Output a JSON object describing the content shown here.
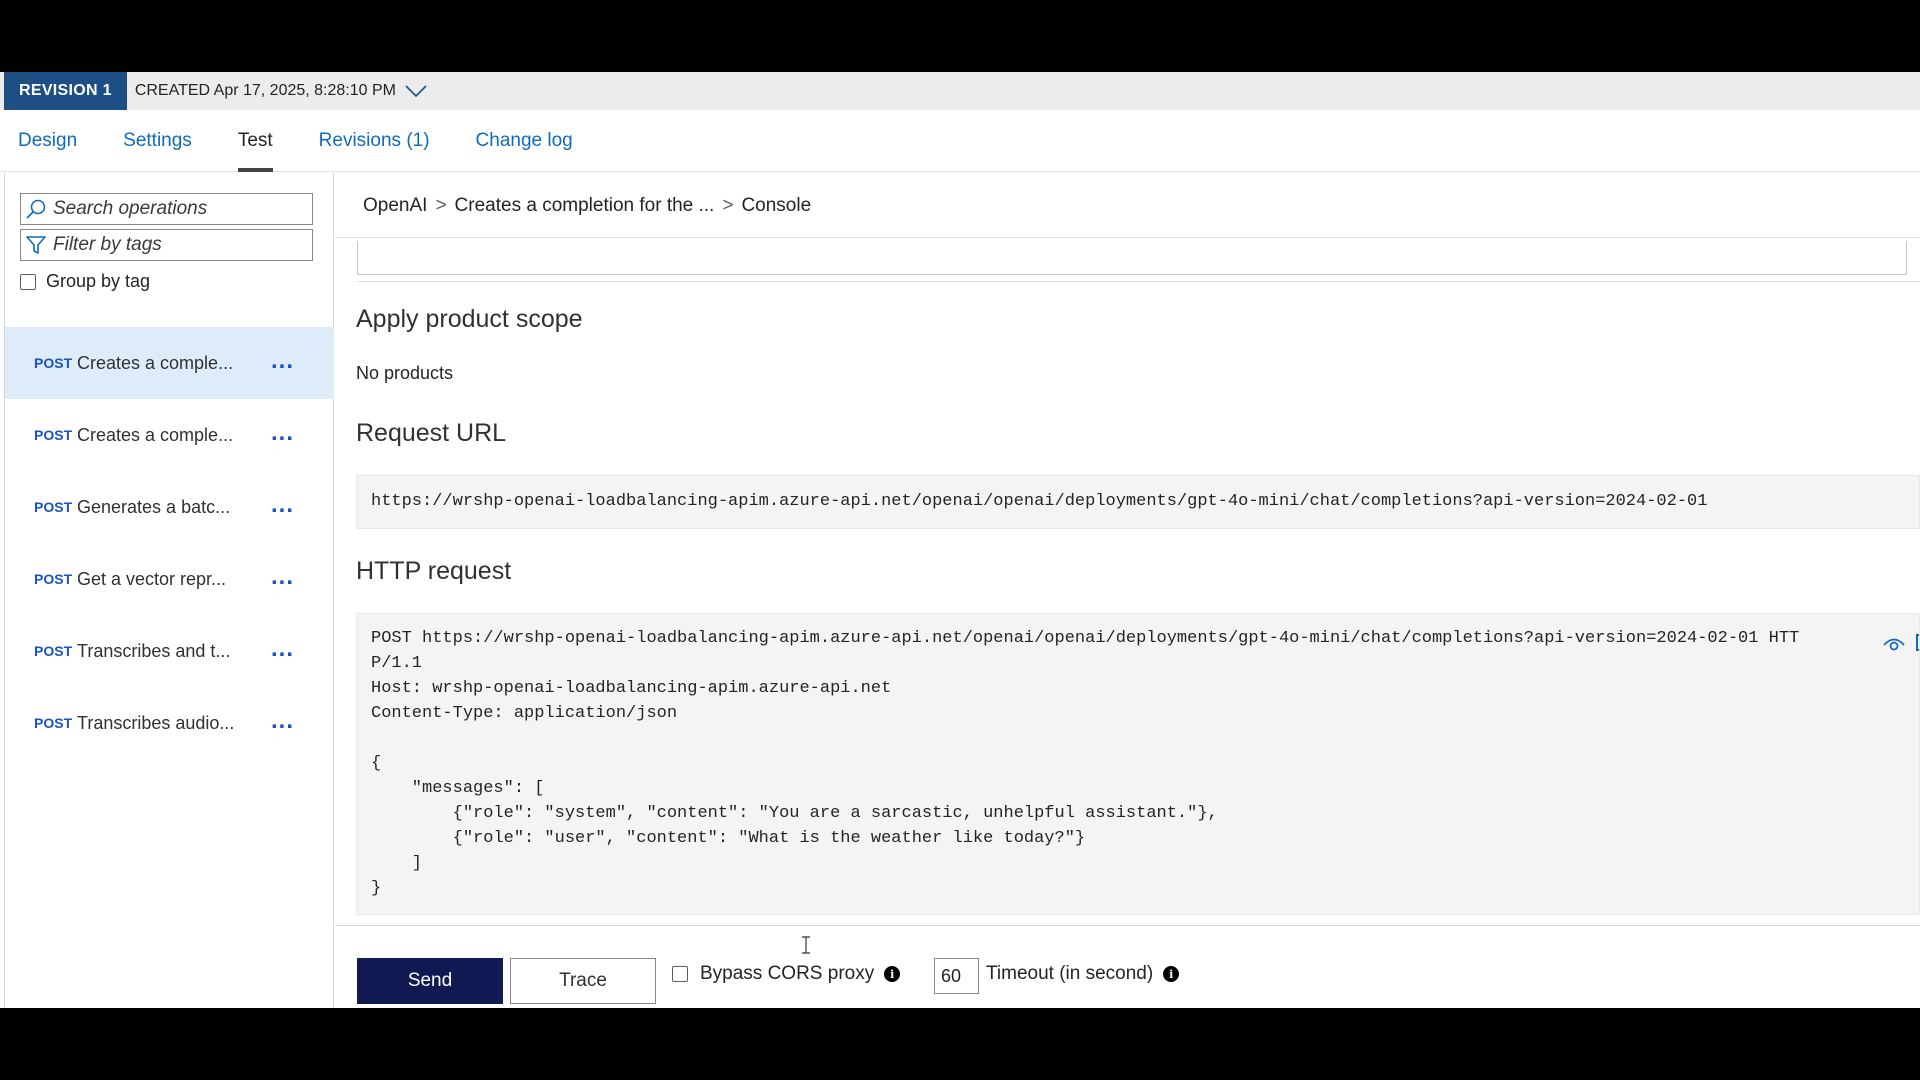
{
  "revision": {
    "badge": "REVISION 1",
    "created": "CREATED Apr 17, 2025, 8:28:10 PM"
  },
  "tabs": [
    {
      "label": "Design"
    },
    {
      "label": "Settings"
    },
    {
      "label": "Test",
      "active": true
    },
    {
      "label": "Revisions (1)"
    },
    {
      "label": "Change log"
    }
  ],
  "sidebar": {
    "search_placeholder": "Search operations",
    "filter_placeholder": "Filter by tags",
    "group_by_tag_label": "Group by tag",
    "group_by_tag_checked": false,
    "operations": [
      {
        "method": "POST",
        "name": "Creates a comple...",
        "more": "...",
        "selected": true
      },
      {
        "method": "POST",
        "name": "Creates a comple...",
        "more": "..."
      },
      {
        "method": "POST",
        "name": "Generates a batc...",
        "more": "..."
      },
      {
        "method": "POST",
        "name": "Get a vector repr...",
        "more": "..."
      },
      {
        "method": "POST",
        "name": "Transcribes and t...",
        "more": "..."
      },
      {
        "method": "POST",
        "name": "Transcribes audio...",
        "more": "..."
      }
    ]
  },
  "breadcrumb": {
    "items": [
      "OpenAI",
      "Creates a completion for the ...",
      "Console"
    ],
    "separator": ">"
  },
  "main": {
    "product_scope_heading": "Apply product scope",
    "product_scope_value": "No products",
    "request_url_heading": "Request URL",
    "request_url": "https://wrshp-openai-loadbalancing-apim.azure-api.net/openai/openai/deployments/gpt-4o-mini/chat/completions?api-version=2024-02-01",
    "http_request_heading": "HTTP request",
    "http_request_text": "POST https://wrshp-openai-loadbalancing-apim.azure-api.net/openai/openai/deployments/gpt-4o-mini/chat/completions?api-version=2024-02-01 HTT\nP/1.1\nHost: wrshp-openai-loadbalancing-apim.azure-api.net\nContent-Type: application/json\n\n{\n    \"messages\": [\n        {\"role\": \"system\", \"content\": \"You are a sarcastic, unhelpful assistant.\"},\n        {\"role\": \"user\", \"content\": \"What is the weather like today?\"}\n    ]\n}"
  },
  "actions": {
    "send_label": "Send",
    "trace_label": "Trace",
    "bypass_cors_label": "Bypass CORS proxy",
    "bypass_cors_checked": false,
    "timeout_value": "60",
    "timeout_label": "Timeout (in second)",
    "info_glyph": "i"
  },
  "icons": {
    "search": "search-icon",
    "filter": "filter-icon",
    "chevron": "chevron-down-icon",
    "eye": "eye-icon",
    "popout": "popout-icon",
    "info": "info-icon"
  },
  "colors": {
    "accent_link": "#0f6cbd",
    "revision_badge": "#1d4f85",
    "send_button": "#111a52",
    "selected_row": "#deecf9",
    "method": "#1a53c5"
  }
}
